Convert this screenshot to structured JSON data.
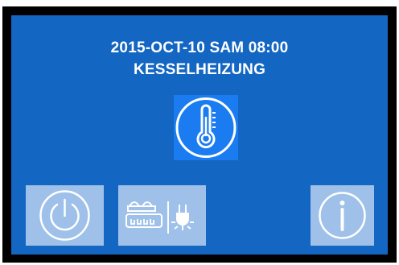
{
  "header": {
    "datetime": "2015-OCT-10 SAM 08:00",
    "mode": "KESSELHEIZUNG"
  },
  "status_icon": {
    "name": "thermometer-icon",
    "background": "#1a7cf0"
  },
  "buttons": [
    {
      "name": "power-button",
      "icon": "power-icon"
    },
    {
      "name": "boiler-grid-mode-button",
      "icon": "boiler-and-plug-icon"
    },
    {
      "name": "info-button",
      "icon": "info-icon"
    }
  ],
  "colors": {
    "screen_background": "#1366c2",
    "frame": "#000000",
    "tile_background": "#9fc0e8",
    "text": "#ffffff"
  }
}
